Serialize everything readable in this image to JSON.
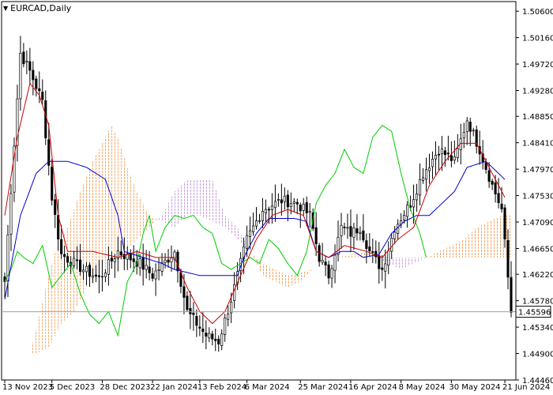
{
  "ticker": {
    "symbol_label": "EURCAD,Daily",
    "menu_icon": "triangle-down-icon"
  },
  "current_price": "1.45596",
  "colors": {
    "candles": "#000000",
    "tenkan": "#cc0000",
    "kijun": "#0000cc",
    "chikou": "#00cc00",
    "kumo_bull": "#f4a460",
    "kumo_bear": "#c9a0dc",
    "price_line": "#a0a0a0"
  },
  "chart_data": {
    "type": "candlestick",
    "indicator": "ichimoku",
    "ylim": [
      1.4446,
      1.5076
    ],
    "y_ticks": [
      "1.50600",
      "1.50160",
      "1.49720",
      "1.49280",
      "1.48850",
      "1.48410",
      "1.47970",
      "1.47530",
      "1.47090",
      "1.46650",
      "1.46220",
      "1.45780",
      "1.45340",
      "1.44900",
      "1.44460"
    ],
    "x_ticks": [
      "13 Nov 2023",
      "5 Dec 2023",
      "28 Dec 2023",
      "22 Jan 2024",
      "13 Feb 2024",
      "6 Mar 2024",
      "25 Mar 2024",
      "16 Apr 2024",
      "8 May 2024",
      "30 May 2024",
      "21 Jun 2024"
    ],
    "close_anchors": [
      [
        0,
        1.461
      ],
      [
        3,
        1.484
      ],
      [
        5,
        1.499
      ],
      [
        8,
        1.496
      ],
      [
        12,
        1.491
      ],
      [
        15,
        1.475
      ],
      [
        18,
        1.4655
      ],
      [
        25,
        1.463
      ],
      [
        30,
        1.4615
      ],
      [
        36,
        1.466
      ],
      [
        43,
        1.464
      ],
      [
        47,
        1.462
      ],
      [
        54,
        1.466
      ],
      [
        58,
        1.456
      ],
      [
        64,
        1.452
      ],
      [
        68,
        1.451
      ],
      [
        72,
        1.458
      ],
      [
        77,
        1.468
      ],
      [
        82,
        1.473
      ],
      [
        88,
        1.4745
      ],
      [
        93,
        1.474
      ],
      [
        97,
        1.472
      ],
      [
        100,
        1.465
      ],
      [
        103,
        1.462
      ],
      [
        107,
        1.47
      ],
      [
        110,
        1.469
      ],
      [
        113,
        1.47
      ],
      [
        116,
        1.466
      ],
      [
        120,
        1.463
      ],
      [
        124,
        1.47
      ],
      [
        129,
        1.474
      ],
      [
        133,
        1.479
      ],
      [
        138,
        1.483
      ],
      [
        143,
        1.481
      ],
      [
        147,
        1.488
      ],
      [
        151,
        1.483
      ],
      [
        155,
        1.477
      ],
      [
        158,
        1.473
      ],
      [
        161,
        1.456
      ]
    ],
    "tenkan_anchors": [
      [
        0,
        1.472
      ],
      [
        4,
        1.485
      ],
      [
        8,
        1.494
      ],
      [
        11,
        1.492
      ],
      [
        14,
        1.487
      ],
      [
        17,
        1.472
      ],
      [
        20,
        1.466
      ],
      [
        28,
        1.466
      ],
      [
        36,
        1.465
      ],
      [
        42,
        1.466
      ],
      [
        48,
        1.465
      ],
      [
        54,
        1.465
      ],
      [
        58,
        1.46
      ],
      [
        62,
        1.456
      ],
      [
        66,
        1.454
      ],
      [
        70,
        1.456
      ],
      [
        75,
        1.462
      ],
      [
        80,
        1.468
      ],
      [
        85,
        1.472
      ],
      [
        90,
        1.473
      ],
      [
        95,
        1.472
      ],
      [
        99,
        1.466
      ],
      [
        103,
        1.465
      ],
      [
        108,
        1.467
      ],
      [
        115,
        1.466
      ],
      [
        120,
        1.465
      ],
      [
        125,
        1.468
      ],
      [
        130,
        1.47
      ],
      [
        135,
        1.477
      ],
      [
        140,
        1.481
      ],
      [
        145,
        1.484
      ],
      [
        150,
        1.484
      ],
      [
        155,
        1.479
      ],
      [
        159,
        1.475
      ]
    ],
    "kijun_anchors": [
      [
        0,
        1.458
      ],
      [
        5,
        1.472
      ],
      [
        10,
        1.479
      ],
      [
        14,
        1.481
      ],
      [
        20,
        1.481
      ],
      [
        26,
        1.48
      ],
      [
        32,
        1.478
      ],
      [
        36,
        1.472
      ],
      [
        38,
        1.466
      ],
      [
        44,
        1.465
      ],
      [
        50,
        1.464
      ],
      [
        54,
        1.463
      ],
      [
        58,
        1.4625
      ],
      [
        62,
        1.462
      ],
      [
        70,
        1.462
      ],
      [
        74,
        1.462
      ],
      [
        76,
        1.465
      ],
      [
        80,
        1.469
      ],
      [
        84,
        1.4715
      ],
      [
        92,
        1.4715
      ],
      [
        96,
        1.471
      ],
      [
        99,
        1.466
      ],
      [
        103,
        1.465
      ],
      [
        107,
        1.466
      ],
      [
        111,
        1.466
      ],
      [
        114,
        1.465
      ],
      [
        119,
        1.4655
      ],
      [
        123,
        1.469
      ],
      [
        127,
        1.471
      ],
      [
        131,
        1.472
      ],
      [
        135,
        1.472
      ],
      [
        139,
        1.474
      ],
      [
        143,
        1.476
      ],
      [
        147,
        1.48
      ],
      [
        153,
        1.481
      ],
      [
        159,
        1.478
      ]
    ],
    "chikou_anchors": [
      [
        0,
        1.461
      ],
      [
        2,
        1.463
      ],
      [
        4,
        1.466
      ],
      [
        6,
        1.465
      ],
      [
        9,
        1.464
      ],
      [
        12,
        1.467
      ],
      [
        15,
        1.46
      ],
      [
        18,
        1.462
      ],
      [
        21,
        1.464
      ],
      [
        24,
        1.459
      ],
      [
        27,
        1.4555
      ],
      [
        30,
        1.454
      ],
      [
        33,
        1.456
      ],
      [
        36,
        1.452
      ],
      [
        39,
        1.461
      ],
      [
        42,
        1.464
      ],
      [
        44,
        1.469
      ],
      [
        46,
        1.472
      ],
      [
        48,
        1.466
      ],
      [
        51,
        1.47
      ],
      [
        54,
        1.472
      ],
      [
        57,
        1.4715
      ],
      [
        60,
        1.472
      ],
      [
        63,
        1.47
      ],
      [
        66,
        1.469
      ],
      [
        69,
        1.464
      ],
      [
        72,
        1.463
      ],
      [
        75,
        1.464
      ],
      [
        78,
        1.465
      ],
      [
        81,
        1.464
      ],
      [
        84,
        1.468
      ],
      [
        87,
        1.4665
      ],
      [
        90,
        1.464
      ],
      [
        93,
        1.462
      ],
      [
        96,
        1.466
      ],
      [
        99,
        1.474
      ],
      [
        102,
        1.477
      ],
      [
        105,
        1.479
      ],
      [
        108,
        1.483
      ],
      [
        111,
        1.48
      ],
      [
        114,
        1.479
      ],
      [
        117,
        1.485
      ],
      [
        120,
        1.487
      ],
      [
        123,
        1.486
      ],
      [
        126,
        1.479
      ],
      [
        129,
        1.473
      ],
      [
        132,
        1.469
      ],
      [
        134,
        1.465
      ]
    ],
    "span_a_anchors": [
      [
        0,
        1.449
      ],
      [
        8,
        1.449
      ],
      [
        10,
        1.453
      ],
      [
        13,
        1.46
      ],
      [
        16,
        1.466
      ],
      [
        20,
        1.47
      ],
      [
        24,
        1.476
      ],
      [
        28,
        1.481
      ],
      [
        32,
        1.485
      ],
      [
        34,
        1.487
      ],
      [
        36,
        1.485
      ],
      [
        39,
        1.48
      ],
      [
        42,
        1.476
      ],
      [
        46,
        1.472
      ],
      [
        50,
        1.471
      ],
      [
        54,
        1.47
      ],
      [
        58,
        1.472
      ],
      [
        62,
        1.472
      ],
      [
        66,
        1.471
      ],
      [
        70,
        1.47
      ],
      [
        74,
        1.468
      ],
      [
        78,
        1.466
      ],
      [
        82,
        1.464
      ],
      [
        86,
        1.463
      ],
      [
        90,
        1.462
      ],
      [
        94,
        1.4625
      ],
      [
        98,
        1.463
      ],
      [
        102,
        1.464
      ],
      [
        106,
        1.465
      ],
      [
        110,
        1.4655
      ],
      [
        114,
        1.466
      ],
      [
        118,
        1.465
      ],
      [
        122,
        1.464
      ],
      [
        126,
        1.463
      ],
      [
        130,
        1.464
      ],
      [
        134,
        1.465
      ],
      [
        138,
        1.466
      ],
      [
        142,
        1.467
      ],
      [
        146,
        1.468
      ],
      [
        150,
        1.47
      ],
      [
        154,
        1.471
      ],
      [
        158,
        1.472
      ],
      [
        161,
        1.472
      ]
    ],
    "span_b_anchors": [
      [
        0,
        1.449
      ],
      [
        8,
        1.449
      ],
      [
        10,
        1.449
      ],
      [
        14,
        1.45
      ],
      [
        18,
        1.454
      ],
      [
        22,
        1.456
      ],
      [
        26,
        1.46
      ],
      [
        30,
        1.462
      ],
      [
        34,
        1.464
      ],
      [
        38,
        1.466
      ],
      [
        42,
        1.468
      ],
      [
        46,
        1.47
      ],
      [
        50,
        1.472
      ],
      [
        54,
        1.476
      ],
      [
        58,
        1.478
      ],
      [
        62,
        1.478
      ],
      [
        66,
        1.478
      ],
      [
        70,
        1.472
      ],
      [
        74,
        1.47
      ],
      [
        78,
        1.466
      ],
      [
        82,
        1.462
      ],
      [
        86,
        1.461
      ],
      [
        90,
        1.46
      ],
      [
        94,
        1.461
      ],
      [
        98,
        1.463
      ],
      [
        102,
        1.464
      ],
      [
        106,
        1.465
      ],
      [
        110,
        1.465
      ],
      [
        114,
        1.465
      ],
      [
        118,
        1.4655
      ],
      [
        122,
        1.465
      ],
      [
        126,
        1.465
      ],
      [
        130,
        1.465
      ],
      [
        134,
        1.465
      ],
      [
        138,
        1.465
      ],
      [
        142,
        1.465
      ],
      [
        146,
        1.465
      ],
      [
        150,
        1.465
      ],
      [
        154,
        1.465
      ],
      [
        158,
        1.465
      ],
      [
        161,
        1.465
      ]
    ]
  }
}
